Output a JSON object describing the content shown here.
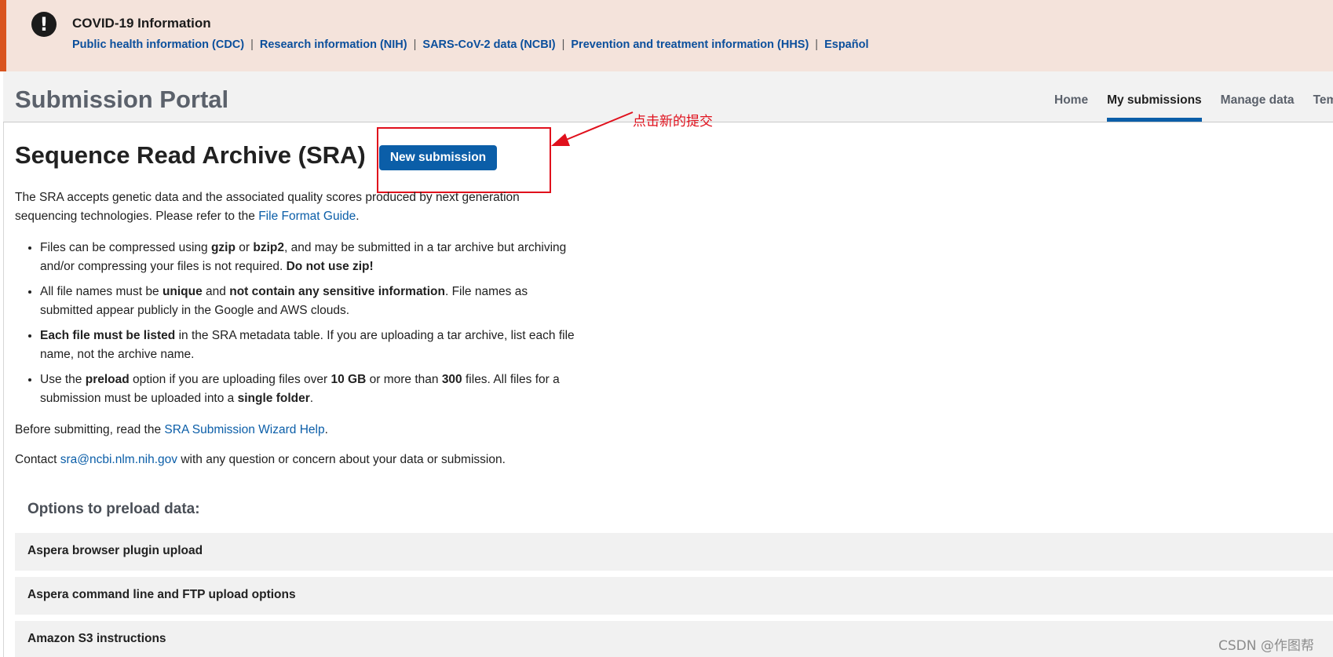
{
  "covid_banner": {
    "title": "COVID-19 Information",
    "links": [
      "Public health information (CDC)",
      "Research information (NIH)",
      "SARS-CoV-2 data (NCBI)",
      "Prevention and treatment information (HHS)",
      "Español"
    ],
    "separator": "|",
    "icon": "exclamation-circle-icon",
    "icon_glyph": "!",
    "accent_color": "#d9541e"
  },
  "header": {
    "title": "Submission Portal",
    "nav": [
      "Home",
      "My submissions",
      "Manage data",
      "Tem"
    ],
    "active_nav": "My submissions"
  },
  "main": {
    "title": "Sequence Read Archive (SRA)",
    "new_submission_label": "New submission",
    "annotation": "点击新的提交",
    "intro_prefix": "The SRA accepts genetic data and the associated quality scores produced by next generation sequencing technologies. Please refer to the ",
    "intro_link": "File Format Guide",
    "intro_suffix": ".",
    "bullets": {
      "b1": {
        "t1": "Files can be compressed using ",
        "s1": "gzip",
        "t2": " or ",
        "s2": "bzip2",
        "t3": ", and may be submitted in a tar archive but archiving and/or compressing your files is not required. ",
        "s3": "Do not use zip!"
      },
      "b2": {
        "t1": "All file names must be ",
        "s1": "unique",
        "t2": " and ",
        "s2": "not contain any sensitive information",
        "t3": ". File names as submitted appear publicly in the Google and AWS clouds."
      },
      "b3": {
        "s1": "Each file must be listed",
        "t1": " in the SRA metadata table. If you are uploading a tar archive, list each file name, not the archive name."
      },
      "b4": {
        "t1": "Use the ",
        "s1": "preload",
        "t2": " option if you are uploading files over ",
        "s2": "10 GB",
        "t3": " or more than ",
        "s3": "300",
        "t4": " files. All files for a submission must be uploaded into a ",
        "s4": "single folder",
        "t5": "."
      }
    },
    "before_prefix": "Before submitting, read the ",
    "before_link": "SRA Submission Wizard Help",
    "before_suffix": ".",
    "contact_prefix": "Contact ",
    "contact_link": "sra@ncbi.nlm.nih.gov",
    "contact_suffix": " with any question or concern about your data or submission."
  },
  "options": {
    "title": "Options to preload data:",
    "items": [
      "Aspera browser plugin upload",
      "Aspera command line and FTP upload options",
      "Amazon S3 instructions"
    ]
  },
  "watermark": "CSDN @作图帮",
  "colors": {
    "link": "#0b5ea8",
    "button": "#0b5ea8",
    "annotation": "#e0101c",
    "banner_bg": "#f4e3db"
  }
}
